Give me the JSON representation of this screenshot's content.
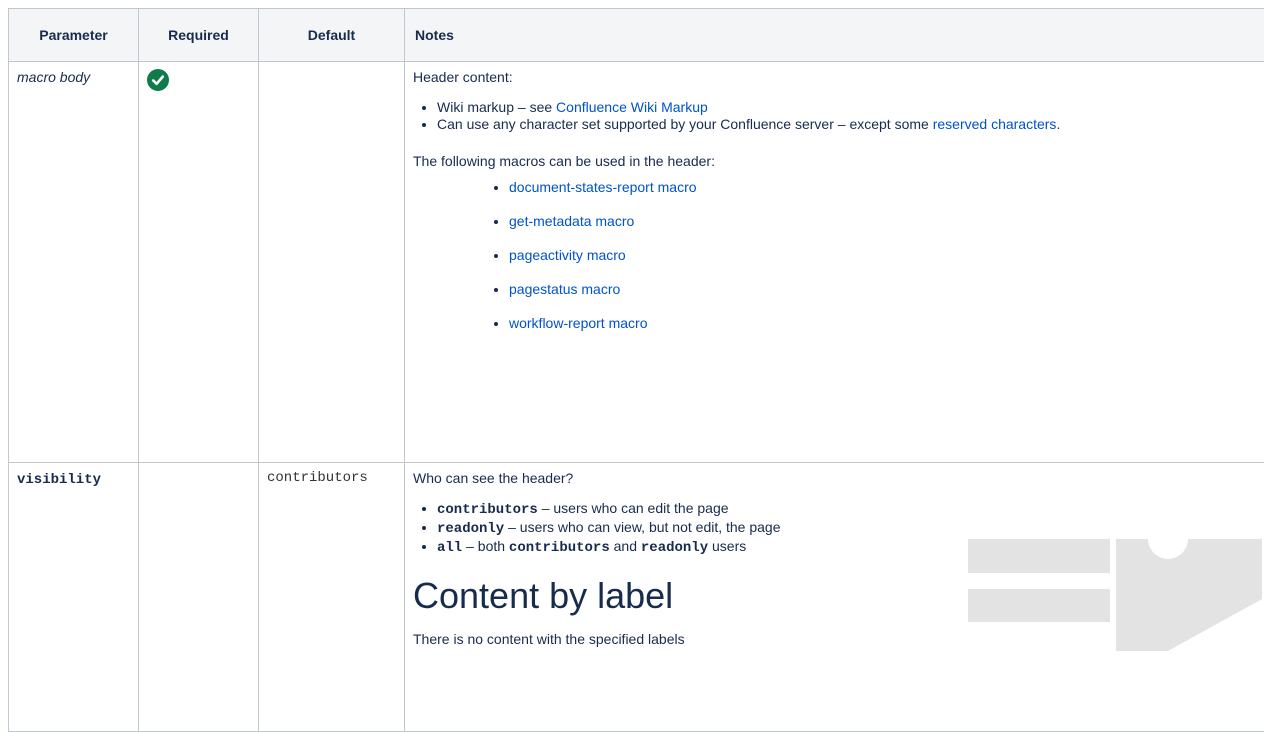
{
  "headers": {
    "parameter": "Parameter",
    "required": "Required",
    "default": "Default",
    "notes": "Notes"
  },
  "rows": [
    {
      "parameter": "macro body",
      "required": true,
      "default": "",
      "notes": {
        "intro": "Header content:",
        "bullets": [
          {
            "text": "Wiki markup – see ",
            "link": "Confluence Wiki Markup",
            "after": ""
          },
          {
            "text": "Can use any character set supported by your Confluence server – except some ",
            "link": "reserved characters",
            "after": "."
          }
        ],
        "macros_intro": "The following macros can be used in the header:",
        "macros": [
          "document-states-report macro",
          "get-metadata macro",
          "pageactivity macro",
          "pagestatus macro",
          "workflow-report macro"
        ]
      }
    },
    {
      "parameter": "visibility",
      "required": false,
      "default": "contributors",
      "notes": {
        "intro": "Who can see the header?",
        "bullets": [
          {
            "code": "contributors",
            "text": " – users who can edit the page"
          },
          {
            "code": "readonly",
            "text": " – users who can view, but not edit, the page"
          },
          {
            "code": "all",
            "text": " – both ",
            "code2": "contributors",
            "mid": " and ",
            "code3": "readonly",
            "after": " users"
          }
        ],
        "heading": "Content by label",
        "empty_message": "There is no content with the specified labels"
      }
    }
  ],
  "colors": {
    "link": "#0052cc",
    "check": "#0f7a4a",
    "header_bg": "#f4f5f7",
    "border": "#c1c7d0",
    "deco": "#e3e3e3"
  },
  "icons": {
    "required": "check-circle-icon"
  }
}
